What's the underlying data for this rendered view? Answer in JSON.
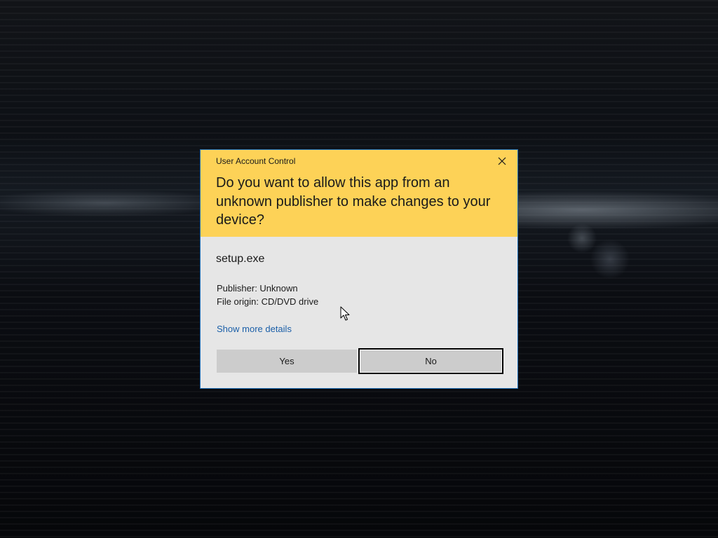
{
  "dialog": {
    "title": "User Account Control",
    "question": "Do you want to allow this app from an unknown publisher to make changes to your device?",
    "app_name": "setup.exe",
    "publisher": "Publisher: Unknown",
    "file_origin": "File origin: CD/DVD drive",
    "more_details_link": "Show more details",
    "yes_label": "Yes",
    "no_label": "No",
    "close_icon": "close-icon"
  },
  "colors": {
    "header": "#fdd257",
    "body": "#e6e6e6",
    "link": "#1b5fa8",
    "button": "#cccccc",
    "border": "#1e6fb8"
  }
}
